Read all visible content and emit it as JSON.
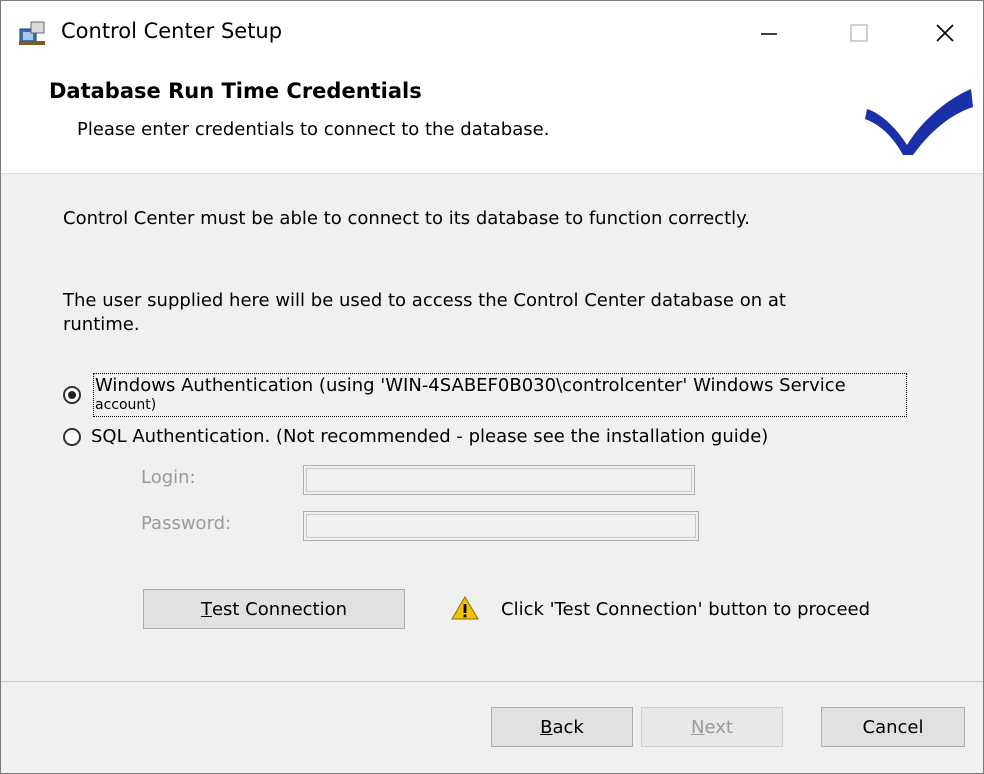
{
  "window": {
    "title": "Control Center Setup"
  },
  "header": {
    "title": "Database Run Time Credentials",
    "subtitle": "Please enter credentials to connect to the database."
  },
  "body": {
    "line1": "Control Center must be able to connect to its database to function correctly.",
    "line2": "The user supplied here will be used to access the Control Center database on  at runtime."
  },
  "auth": {
    "selected": "windows",
    "windows_label_1": "Windows Authentication (using 'WIN-4SABEF0B030\\controlcenter' Windows Service",
    "windows_label_2": "account)",
    "sql_label": "SQL Authentication. (Not recommended - please see the installation guide)"
  },
  "fields": {
    "login_label": "Login:",
    "login_value": "",
    "password_label": "Password:",
    "password_value": ""
  },
  "test": {
    "button_first": "T",
    "button_rest": "est Connection",
    "status": "Click 'Test Connection' button to proceed"
  },
  "footer": {
    "back_first": "B",
    "back_rest": "ack",
    "next_first": "N",
    "next_rest": "ext",
    "cancel": "Cancel"
  },
  "colors": {
    "accent": "#1a2fa8",
    "warning": "#f2c200"
  }
}
